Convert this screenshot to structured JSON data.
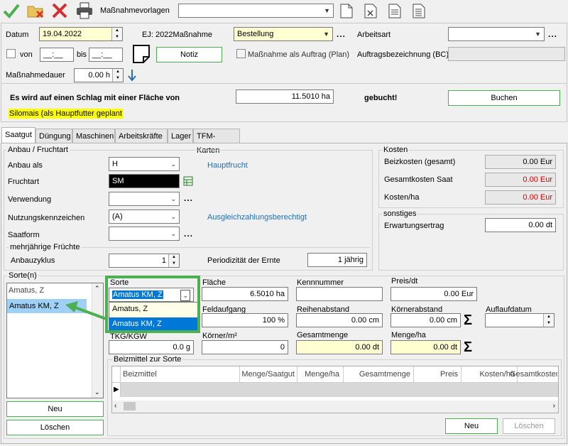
{
  "toolbar": {
    "vorlagen_label": "Maßnahmevorlagen",
    "vorlagen_value": ""
  },
  "header": {
    "datum_label": "Datum",
    "datum_value": "19.04.2022",
    "ej_label": "EJ: 2022Maßnahme",
    "massnahme_value": "Bestellung",
    "arbeitsart_label": "Arbeitsart",
    "arbeitsart_value": "",
    "von_label": "von",
    "von_value": "__:__",
    "bis_label": "bis",
    "bis_value": "__:__",
    "notiz_label": "Notiz",
    "auftrag_label": "Maßnahme als Auftrag (Plan)",
    "auftragsbez_label": "Auftragsbezeichnung (BC)",
    "auftragsbez_value": "",
    "dauer_label": "Maßnahmedauer",
    "dauer_value": "0.00 h"
  },
  "booking": {
    "text": "Es wird auf einen Schlag mit einer Fläche von",
    "flaeche": "11.5010 ha",
    "gebucht": "gebucht!",
    "buchen_label": "Buchen",
    "highlight": "Silomais (als Hauptfutter geplant"
  },
  "tabs": [
    "Saatgut",
    "Düngung",
    "Maschinen",
    "Arbeitskräfte",
    "Lager",
    "TFM-Karten"
  ],
  "anbau": {
    "title": "Anbau / Fruchtart",
    "anbau_als_label": "Anbau als",
    "anbau_als_value": "H",
    "anbau_als_info": "Hauptfrucht",
    "fruchtart_label": "Fruchtart",
    "fruchtart_value": "SM",
    "verwendung_label": "Verwendung",
    "verwendung_value": "",
    "nutzung_label": "Nutzungskennzeichen",
    "nutzung_value": "(A)",
    "nutzung_info": "Ausgleichzahlungsberechtigt",
    "saatform_label": "Saatform",
    "saatform_value": "",
    "mehrjaehrig_title": "mehrjährige Früchte",
    "anbauzyklus_label": "Anbauzyklus",
    "anbauzyklus_value": "1",
    "periodizitaet_label": "Periodizität der Ernte",
    "periodizitaet_value": "1 jährig"
  },
  "kosten": {
    "title": "Kosten",
    "beiz_label": "Beizkosten (gesamt)",
    "beiz_value": "0.00 Eur",
    "saat_label": "Gesamtkosten Saat",
    "saat_value": "0.00 Eur",
    "ha_label": "Kosten/ha",
    "ha_value": "0.00 Eur"
  },
  "sonstiges": {
    "title": "sonstiges",
    "ertrag_label": "Erwartungsertrag",
    "ertrag_value": "0.00 dt"
  },
  "sorten": {
    "title": "Sorte(n)",
    "items": [
      "Amatus, Z",
      "Amatus KM, Z"
    ],
    "neu_label": "Neu",
    "loeschen_label": "Löschen"
  },
  "sorte_detail": {
    "sorte_label": "Sorte",
    "sorte_value": "Amatus KM, Z",
    "dropdown_options": [
      "Amatus, Z",
      "Amatus KM, Z"
    ],
    "flaeche_label": "Fläche",
    "flaeche_value": "6.5010 ha",
    "kennnummer_label": "Kennnummer",
    "kennnummer_value": "",
    "preis_label": "Preis/dt",
    "preis_value": "0.00 Eur",
    "feldaufgang_label": "Feldaufgang",
    "feldaufgang_value": "100 %",
    "reihenabstand_label": "Reihenabstand",
    "reihenabstand_value": "0.00 cm",
    "koernerabstand_label": "Körnerabstand",
    "koernerabstand_value": "0.00 cm",
    "auflaufdatum_label": "Auflaufdatum",
    "auflaufdatum_value": "",
    "tkg_label": "TKG/KGW",
    "tkg_value": "0.0 g",
    "koerner_label": "Körner/m²",
    "koerner_value": "0",
    "gesamtmenge_label": "Gesamtmenge",
    "gesamtmenge_value": "0.00 dt",
    "menge_label": "Menge/ha",
    "menge_value": "0.00 dt"
  },
  "beizmittel": {
    "title": "Beizmittel zur Sorte",
    "columns": [
      "Beizmittel",
      "Menge/Saatgut",
      "Menge/ha",
      "Gesamtmenge",
      "Preis",
      "Kosten/ha",
      "Gesamtkosten"
    ],
    "neu_label": "Neu",
    "loeschen_label": "Löschen"
  },
  "colors": {
    "accent_green": "#4caf50",
    "highlight_yellow": "#ffff00",
    "selection_blue": "#0078d7",
    "link_blue": "#1e6fb5"
  }
}
